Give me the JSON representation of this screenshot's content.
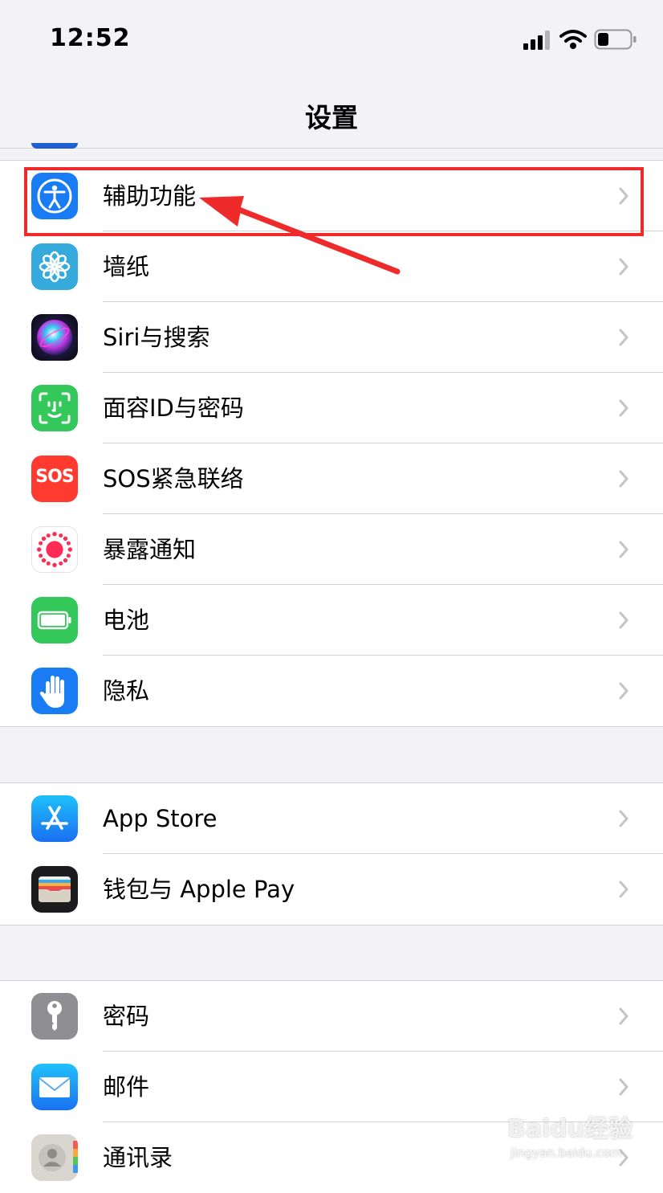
{
  "status_bar": {
    "time": "12:52"
  },
  "nav": {
    "title": "设置"
  },
  "groups": [
    {
      "items": [
        {
          "label": "辅助功能",
          "icon": "accessibility-icon"
        },
        {
          "label": "墙纸",
          "icon": "wallpaper-flower-icon"
        },
        {
          "label": "Siri与搜索",
          "icon": "siri-icon"
        },
        {
          "label": "面容ID与密码",
          "icon": "face-id-icon"
        },
        {
          "label": "SOS紧急联络",
          "icon": "sos-icon",
          "icon_text": "SOS"
        },
        {
          "label": "暴露通知",
          "icon": "exposure-notification-icon"
        },
        {
          "label": "电池",
          "icon": "battery-icon"
        },
        {
          "label": "隐私",
          "icon": "privacy-hand-icon"
        }
      ]
    },
    {
      "items": [
        {
          "label": "App Store",
          "icon": "app-store-icon"
        },
        {
          "label": "钱包与 Apple Pay",
          "icon": "wallet-icon"
        }
      ]
    },
    {
      "items": [
        {
          "label": "密码",
          "icon": "key-icon"
        },
        {
          "label": "邮件",
          "icon": "mail-icon"
        },
        {
          "label": "通讯录",
          "icon": "contacts-icon"
        }
      ]
    }
  ],
  "watermark": {
    "logo": "Baidu经验",
    "url": "jingyan.baidu.com"
  },
  "colors": {
    "accessibility": "#1a7cf5",
    "wallpaper": "#36aadc",
    "faceid": "#34c759",
    "sos": "#ff3b30",
    "battery": "#34c759",
    "privacy": "#1a7cf5",
    "appstore": "#1e8cf5",
    "mail": "#1a8cf7",
    "annotation": "#ee2a2a"
  }
}
